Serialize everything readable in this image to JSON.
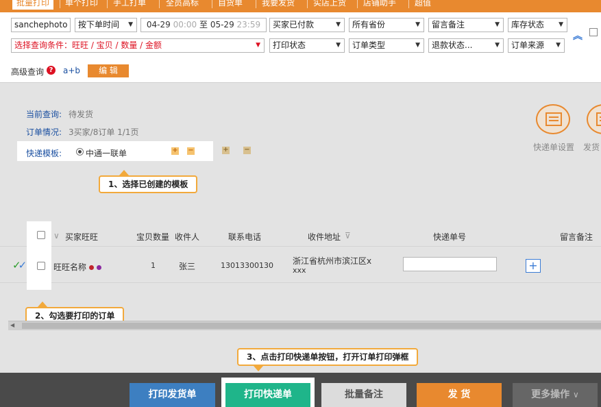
{
  "topnav": {
    "tabs": [
      "批量打印",
      "单个打印",
      "手工打单",
      "全员高标",
      "自货单",
      "我要发货",
      "实店上货",
      "店铺助手",
      "超值"
    ]
  },
  "filters": {
    "buyer_input_value": "sanchephoto",
    "order_time": "按下单时间",
    "date_start": "04-29",
    "date_start_time": "00:00",
    "date_sep": "至",
    "date_end": "05-29",
    "date_end_time": "23:59",
    "payment_status": "买家已付款",
    "province": "所有省份",
    "remark": "留言备注",
    "stock_status": "库存状态",
    "query_condition": "选择查询条件：旺旺 / 宝贝 / 数量 / 金额",
    "print_status": "打印状态",
    "order_type": "订单类型",
    "refund_status": "退款状态...",
    "order_source": "订单来源"
  },
  "advanced": {
    "label": "高级查询",
    "help": "?",
    "value": "a+b",
    "edit_label": "编 辑"
  },
  "info": {
    "current_query_label": "当前查询:",
    "current_query_value": "待发货",
    "order_info_label": "订单情况:",
    "order_info_value": "3买家/8订单  1/1页",
    "template_label": "快递模板:",
    "template_name": "中通一联单",
    "plus": "+",
    "minus": "−"
  },
  "right_icons": {
    "express_settings": "快递单设置",
    "ship_settings": "发货"
  },
  "callouts": {
    "step1": "1、选择已创建的模板",
    "step2": "2、勾选要打印的订单",
    "step3": "3、点击打印快递单按钮，打开订单打印弹框"
  },
  "table": {
    "headers": {
      "buyer": "买家旺旺",
      "qty": "宝贝数量",
      "recipient": "收件人",
      "phone": "联系电话",
      "address": "收件地址",
      "tracking": "快递单号",
      "remark": "留言备注"
    },
    "rows": [
      {
        "buyer": "旺旺名称",
        "qty": "1",
        "recipient": "张三",
        "phone": "13013300130",
        "address_line1": "浙江省杭州市滨江区x",
        "address_line2": "xxx"
      }
    ]
  },
  "bottom": {
    "print_invoice": "打印发货单",
    "print_express": "打印快递单",
    "batch_remark": "批量备注",
    "ship": "发 货",
    "more": "更多操作"
  },
  "colors": {
    "accent": "#e8892f",
    "green_btn": "#1fb58a",
    "blue_btn": "#3d7fc1",
    "link": "#1a4fa0"
  }
}
